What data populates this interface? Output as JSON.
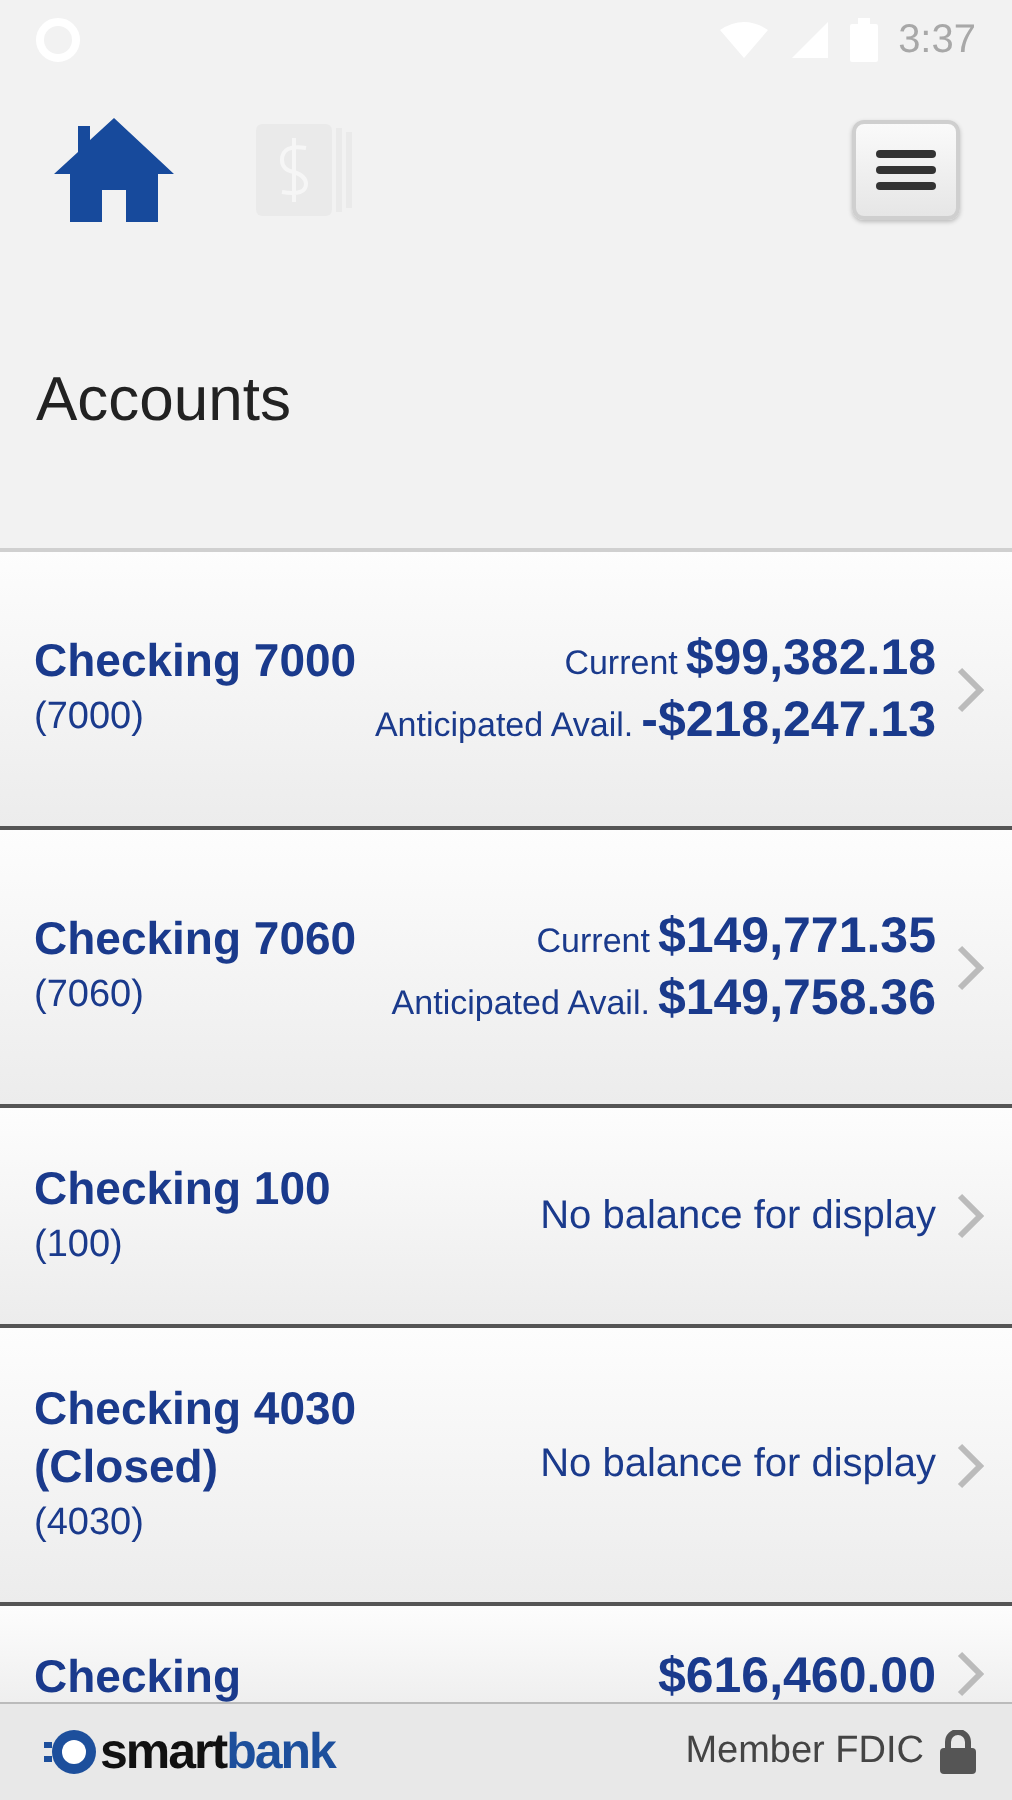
{
  "status_bar": {
    "time": "3:37"
  },
  "nav": [
    {
      "kind": "home",
      "selected": true
    },
    {
      "kind": "money",
      "selected": false
    }
  ],
  "title": "Accounts",
  "accounts": [
    {
      "kind": "balances",
      "name": "Checking 7000",
      "number": "(7000)",
      "balances": [
        {
          "label": "Current",
          "amount": "$99,382.18"
        },
        {
          "label": "Anticipated Avail.",
          "amount": "-$218,247.13"
        }
      ]
    },
    {
      "kind": "balances",
      "name": "Checking 7060",
      "number": "(7060)",
      "balances": [
        {
          "label": "Current",
          "amount": "$149,771.35"
        },
        {
          "label": "Anticipated Avail.",
          "amount": "$149,758.36"
        }
      ]
    },
    {
      "kind": "no_balance",
      "name": "Checking 100",
      "number": "(100)",
      "message": "No balance for display"
    },
    {
      "kind": "no_balance",
      "name": "Checking 4030 (Closed)",
      "number": "(4030)",
      "message": "No balance for display"
    },
    {
      "kind": "balances",
      "name": "Checking",
      "balances": [
        {
          "amount": "$616,460.00"
        }
      ]
    }
  ],
  "footer": {
    "logo": {
      "text_1": "smart",
      "text_2": "bank"
    },
    "note": "Member FDIC"
  }
}
